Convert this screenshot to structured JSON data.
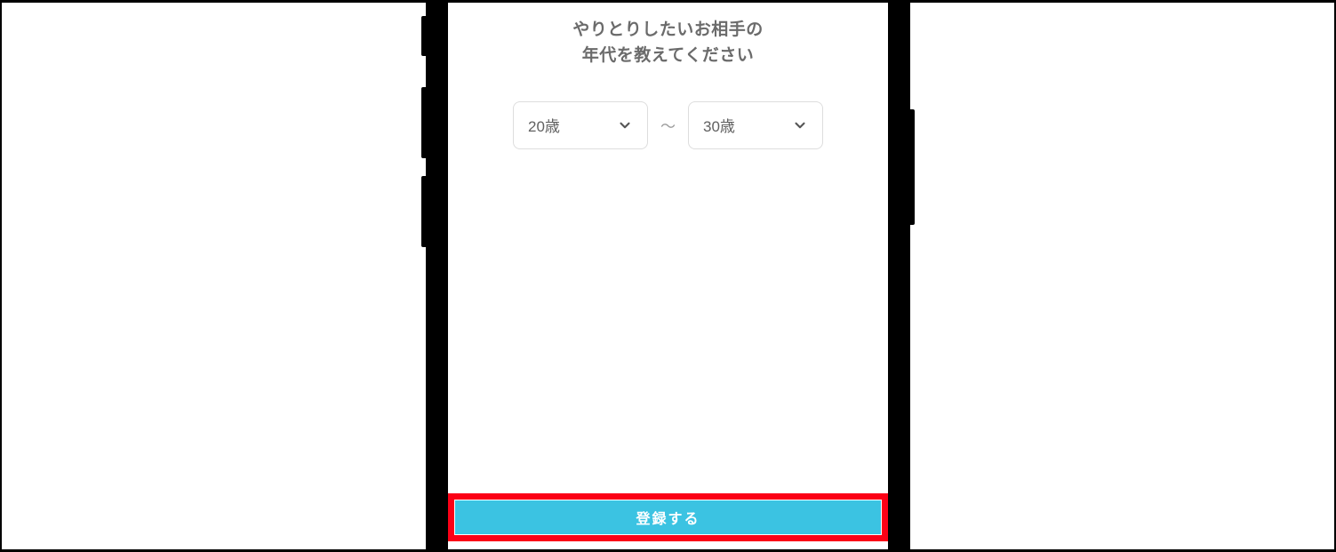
{
  "prompt": {
    "line1": "やりとりしたいお相手の",
    "line2": "年代を教えてください"
  },
  "age_selector": {
    "min_value": "20歳",
    "separator": "〜",
    "max_value": "30歳"
  },
  "register_button_label": "登録する"
}
